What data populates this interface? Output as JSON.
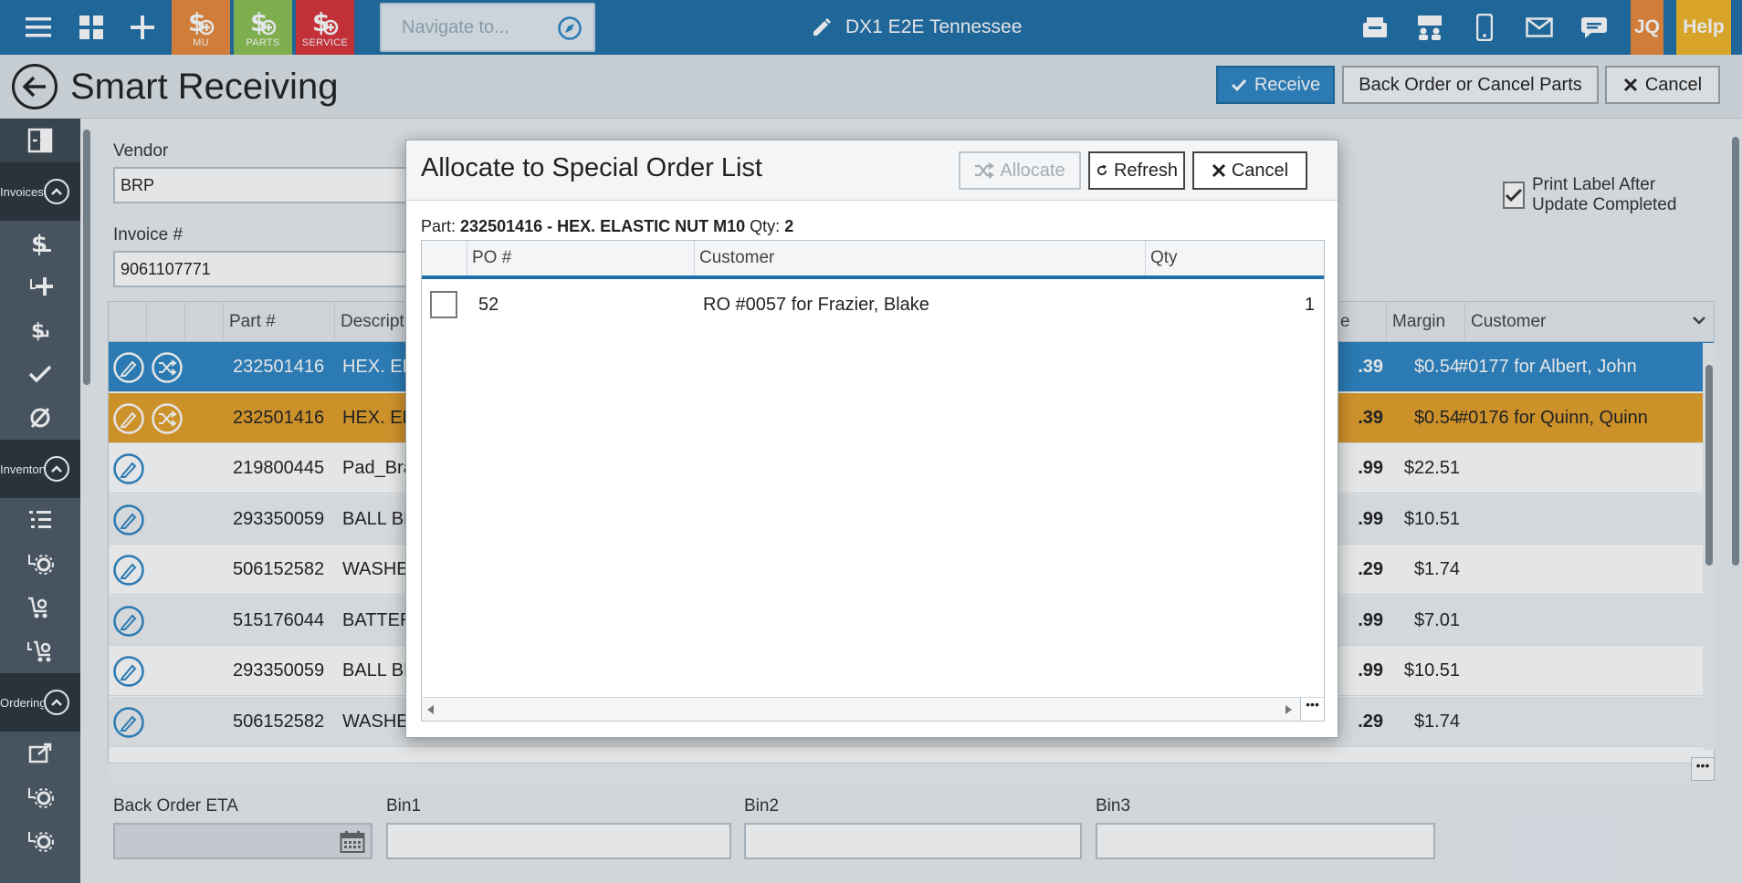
{
  "topbar": {
    "modules": [
      {
        "label": "MU",
        "color": "#e8893a"
      },
      {
        "label": "PARTS",
        "color": "#8cc152"
      },
      {
        "label": "SERVICE",
        "color": "#d9333a"
      }
    ],
    "nav_placeholder": "Navigate to...",
    "store_name": "DX1 E2E Tennessee",
    "user_initials": "JQ",
    "help_label": "Help",
    "user_color": "#e8893a",
    "help_color": "#f1b528"
  },
  "header": {
    "title": "Smart Receiving",
    "receive_label": "Receive",
    "backorder_label": "Back Order or Cancel Parts",
    "cancel_label": "Cancel"
  },
  "sidebar": {
    "sections": [
      "Invoices",
      "Inventory",
      "Ordering"
    ]
  },
  "form": {
    "vendor_label": "Vendor",
    "vendor_value": "BRP",
    "invoice_label": "Invoice #",
    "invoice_value": "9061107771",
    "print_label": "Print Label After Update Completed",
    "back_order_eta_label": "Back Order ETA",
    "bin1_label": "Bin1",
    "bin2_label": "Bin2",
    "bin3_label": "Bin3"
  },
  "grid": {
    "headers": {
      "part": "Part #",
      "description": "Descript",
      "price": "e",
      "margin": "Margin",
      "customer": "Customer"
    },
    "rows": [
      {
        "part": "232501416",
        "desc": "HEX. EL",
        "price": ".39",
        "margin": "$0.54",
        "customer": "#0177 for Albert, John"
      },
      {
        "part": "232501416",
        "desc": "HEX. EL",
        "price": ".39",
        "margin": "$0.54",
        "customer": "#0176 for Quinn, Quinn"
      },
      {
        "part": "219800445",
        "desc": "Pad_Bra",
        "price": ".99",
        "margin": "$22.51",
        "customer": ""
      },
      {
        "part": "293350059",
        "desc": "BALL BE",
        "price": ".99",
        "margin": "$10.51",
        "customer": ""
      },
      {
        "part": "506152582",
        "desc": "WASHE",
        "price": ".29",
        "margin": "$1.74",
        "customer": ""
      },
      {
        "part": "515176044",
        "desc": "BATTER",
        "price": ".99",
        "margin": "$7.01",
        "customer": ""
      },
      {
        "part": "293350059",
        "desc": "BALL BE",
        "price": ".99",
        "margin": "$10.51",
        "customer": ""
      },
      {
        "part": "506152582",
        "desc": "WASHE",
        "price": ".29",
        "margin": "$1.74",
        "customer": ""
      }
    ]
  },
  "modal": {
    "title": "Allocate to Special Order List",
    "allocate_label": "Allocate",
    "refresh_label": "Refresh",
    "cancel_label": "Cancel",
    "part_prefix": "Part:",
    "part_value": "232501416 - HEX. ELASTIC NUT M10",
    "qty_prefix": "Qty:",
    "qty_value": "2",
    "columns": {
      "po": "PO #",
      "customer": "Customer",
      "qty": "Qty"
    },
    "rows": [
      {
        "po": "52",
        "customer": "RO #0057 for Frazier, Blake",
        "qty": "1"
      }
    ]
  },
  "colors": {
    "topbar": "#1f6fa8",
    "primary": "#2d86c5",
    "selected_orange": "#e5a02a",
    "sidebar": "#4d5b66"
  }
}
